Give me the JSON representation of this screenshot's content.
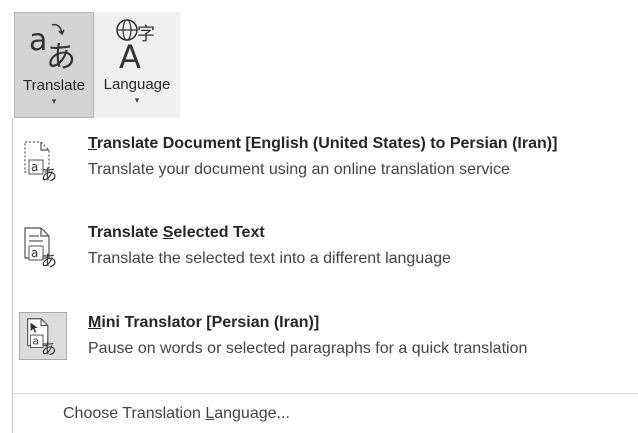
{
  "ribbon": {
    "translate": {
      "label": "Translate",
      "caret": "▾"
    },
    "language": {
      "label": "Language",
      "caret": "▾"
    }
  },
  "menu": {
    "translate_document": {
      "title_accel": "T",
      "title_rest": "ranslate Document [English (United States) to Persian (Iran)]",
      "description": "Translate your document using an online translation service"
    },
    "translate_selected": {
      "title_pre": "Translate ",
      "title_accel": "S",
      "title_rest": "elected Text",
      "description": "Translate the selected text into a different language"
    },
    "mini_translator": {
      "title_accel": "M",
      "title_rest": "ini Translator [Persian (Iran)]",
      "description": "Pause on words or selected paragraphs for a quick translation"
    },
    "choose_language": {
      "label_pre": "Choose Translation ",
      "label_accel": "L",
      "label_rest": "anguage..."
    }
  },
  "icons": {
    "translate": "translate-icon",
    "language": "language-globe-icon",
    "document": "translate-document-icon",
    "selected": "translate-selected-text-icon",
    "mini": "mini-translator-icon"
  }
}
